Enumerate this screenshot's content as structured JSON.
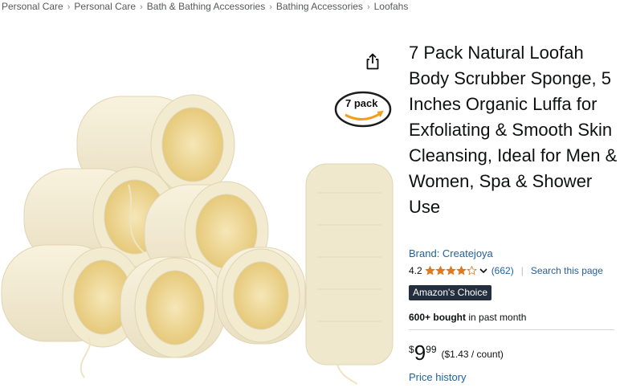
{
  "breadcrumbs": [
    "Personal Care",
    "Personal Care",
    "Bath & Bathing Accessories",
    "Bathing Accessories",
    "Loofahs"
  ],
  "breadcrumb_separator": "›",
  "product": {
    "title": "7 Pack Natural Loofah Body Scrubber Sponge, 5 Inches Organic Luffa for Exfoliating & Smooth Skin Cleansing, Ideal for Men & Women, Spa & Shower Use",
    "brand": "Brand: Createjoya",
    "image_badge": "7 pack"
  },
  "rating": {
    "value": "4.2",
    "stars": 4.2,
    "count": "(662)",
    "search_page": "Search this page",
    "separator": "|"
  },
  "badge": "Amazon's Choice",
  "bought": {
    "count": "600+ bought",
    "period": "in past month"
  },
  "price": {
    "symbol": "$",
    "whole": "9",
    "fraction": "99",
    "unit_price": "($1.43 / count)"
  },
  "price_history": "Price history",
  "colors": {
    "link": "#2162a1",
    "star": "#de7921",
    "badge_bg": "#232f3e",
    "text": "#0f1111"
  },
  "icons": [
    "share-icon",
    "star-icon",
    "chevron-down-icon"
  ]
}
